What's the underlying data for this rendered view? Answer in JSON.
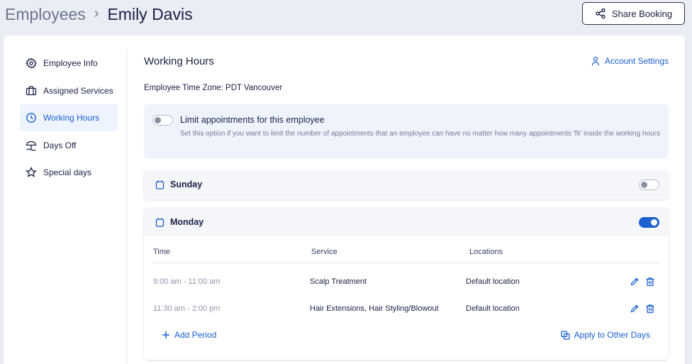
{
  "header": {
    "parent": "Employees",
    "separator": "›",
    "current": "Emily Davis",
    "share_label": "Share Booking"
  },
  "sidebar": {
    "items": [
      {
        "label": "Employee Info",
        "icon": "gear-icon"
      },
      {
        "label": "Assigned Services",
        "icon": "briefcase-icon"
      },
      {
        "label": "Working Hours",
        "icon": "clock-icon",
        "active": true
      },
      {
        "label": "Days Off",
        "icon": "beach-umbrella-icon"
      },
      {
        "label": "Special days",
        "icon": "star-icon"
      }
    ]
  },
  "main": {
    "title": "Working Hours",
    "account_settings": "Account Settings",
    "timezone": "Employee Time Zone: PDT Vancouver",
    "limit": {
      "title": "Limit appointments for this employee",
      "description": "Set this option if you want to limit the number of appointments that an employee can have no matter how many appointments 'fit' inside the working hours",
      "enabled": false
    },
    "days": [
      {
        "name": "Sunday",
        "enabled": false
      },
      {
        "name": "Monday",
        "enabled": true
      }
    ],
    "table": {
      "headers": [
        "Time",
        "Service",
        "Locations"
      ],
      "rows": [
        {
          "time": "9:00 am - 11:00 am",
          "service": "Scalp Treatment",
          "location": "Default location"
        },
        {
          "time": "11:30 am - 2:00 pm",
          "service": "Hair Extensions, Hair Styling/Blowout",
          "location": "Default location"
        }
      ]
    },
    "add_period": "Add Period",
    "apply_other_days": "Apply to Other Days"
  },
  "colors": {
    "accent": "#1c5fd1",
    "background": "#ebedf4",
    "active_bg": "#eef4ff",
    "limit_bg": "#eff4fc"
  }
}
